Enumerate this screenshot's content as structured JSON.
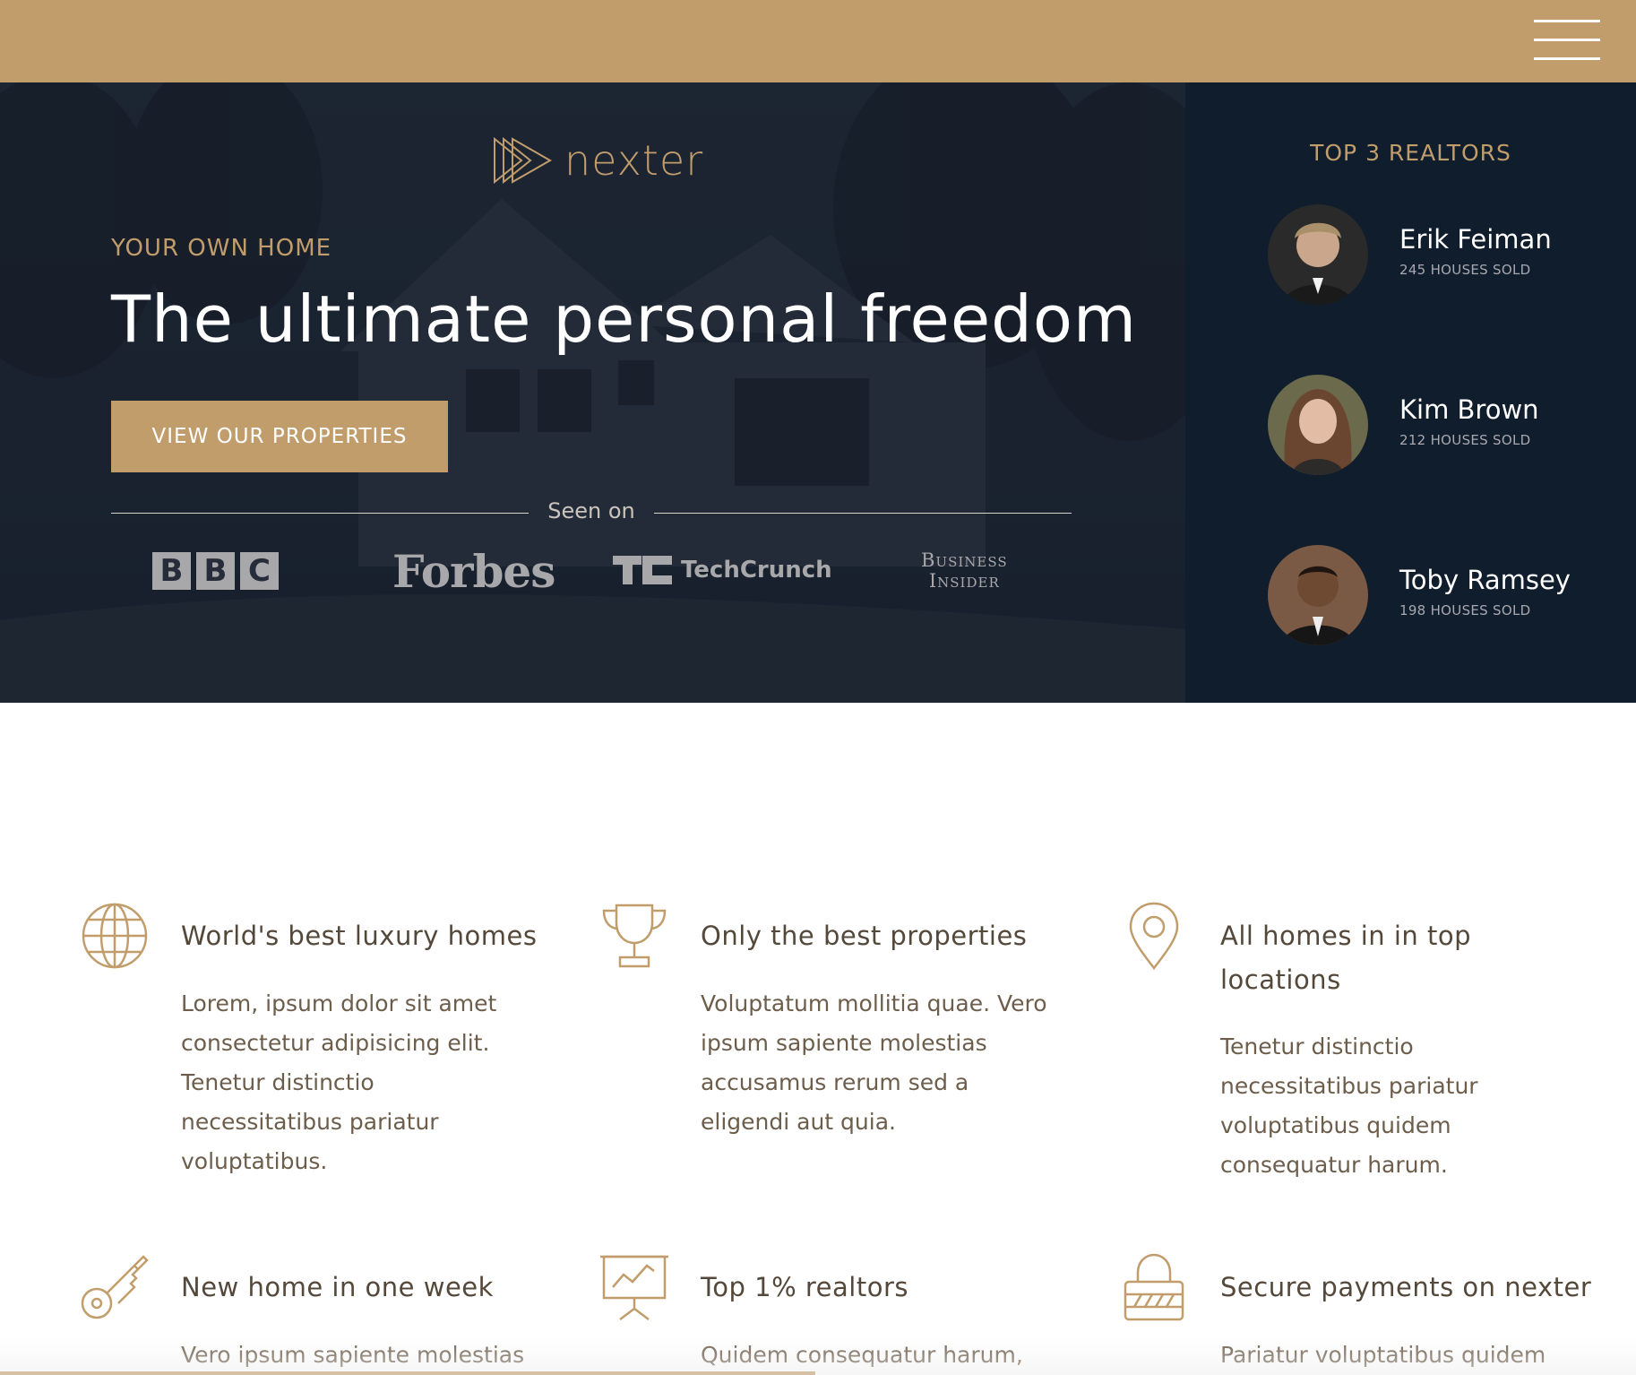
{
  "header": {
    "menu_icon": "hamburger-menu-icon"
  },
  "hero": {
    "logo_text": "nexter",
    "logo_icon": "nexter-triangles-icon",
    "subheading": "Your own home",
    "heading": "The ultimate personal freedom",
    "cta_label": "View our properties",
    "seen_on": "Seen on",
    "brands": {
      "bbc": [
        "B",
        "B",
        "C"
      ],
      "forbes": "Forbes",
      "techcrunch": "TechCrunch",
      "business_insider_line1": "Business",
      "business_insider_line2": "Insider"
    }
  },
  "realtors": {
    "title": "Top 3 Realtors",
    "items": [
      {
        "name": "Erik Feiman",
        "sold": "245 houses sold",
        "avatar": "avatar-photo"
      },
      {
        "name": "Kim Brown",
        "sold": "212 houses sold",
        "avatar": "avatar-photo"
      },
      {
        "name": "Toby Ramsey",
        "sold": "198 houses sold",
        "avatar": "avatar-photo"
      }
    ]
  },
  "features": [
    {
      "icon": "globe-icon",
      "title": "World's best luxury homes",
      "text": "Lorem, ipsum dolor sit amet consectetur adipisicing elit. Tenetur distinctio necessitatibus pariatur voluptatibus."
    },
    {
      "icon": "trophy-icon",
      "title": "Only the best properties",
      "text": "Voluptatum mollitia quae. Vero ipsum sapiente molestias accusamus rerum sed a eligendi aut quia."
    },
    {
      "icon": "map-pin-icon",
      "title": "All homes in in top locations",
      "text": "Tenetur distinctio necessitatibus pariatur voluptatibus quidem consequatur harum."
    },
    {
      "icon": "key-icon",
      "title": "New home in one week",
      "text": "Vero ipsum sapiente molestias"
    },
    {
      "icon": "presentation-chart-icon",
      "title": "Top 1% realtors",
      "text": "Quidem consequatur harum,"
    },
    {
      "icon": "lock-icon",
      "title": "Secure payments on nexter",
      "text": "Pariatur voluptatibus quidem"
    }
  ],
  "colors": {
    "primary": "#C19D6C",
    "dark": "#101D2C",
    "text": "#54483A",
    "white": "#FFFFFF"
  }
}
